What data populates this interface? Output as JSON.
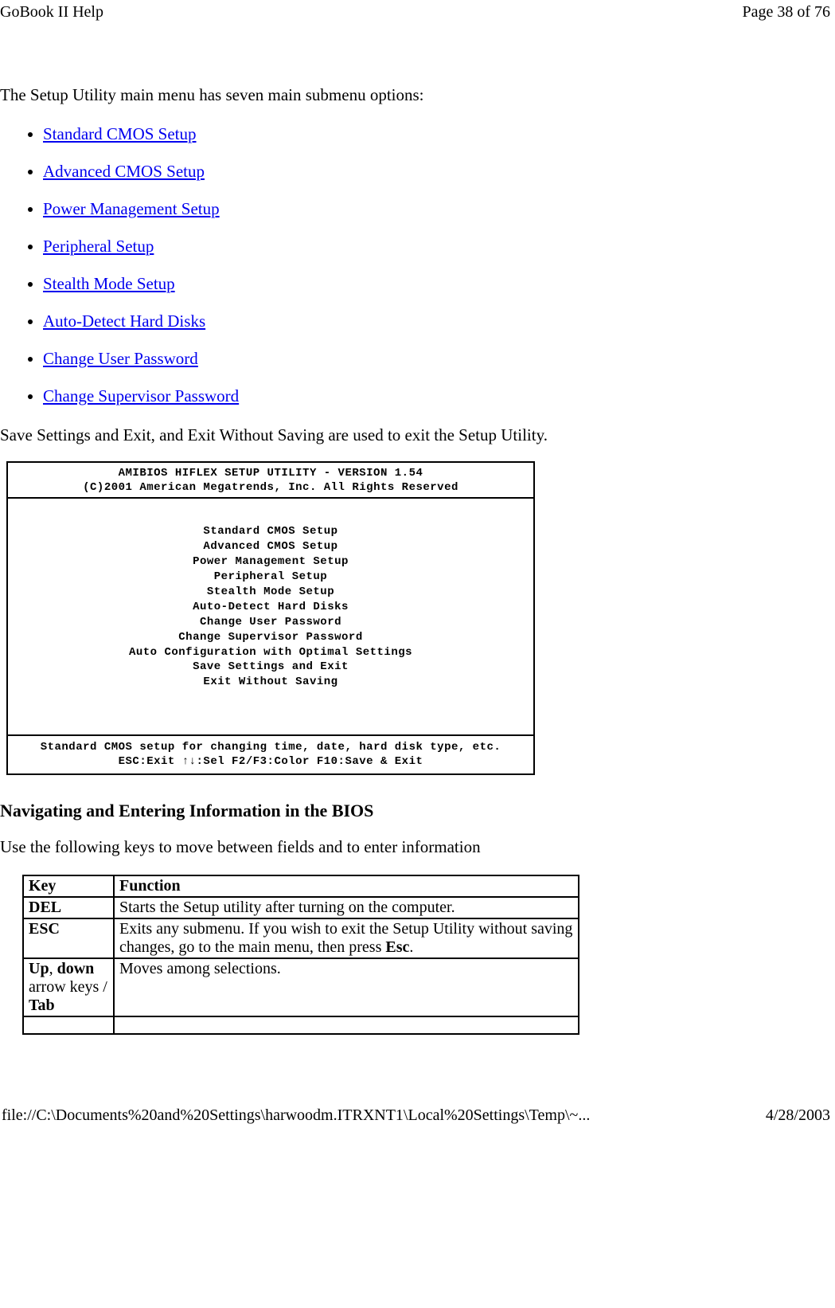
{
  "header": {
    "left": "GoBook II Help",
    "right": "Page 38 of 76"
  },
  "intro": "The Setup Utility main menu has seven main submenu options:",
  "links": [
    "Standard CMOS Setup",
    "Advanced CMOS Setup",
    "Power Management Setup",
    "Peripheral Setup",
    "Stealth Mode Setup",
    "Auto-Detect Hard Disks",
    "Change User Password",
    "Change Supervisor Password"
  ],
  "exit_note": "Save Settings and Exit, and Exit Without Saving are used to exit the Setup Utility.",
  "bios": {
    "header_line1": "AMIBIOS HIFLEX SETUP UTILITY - VERSION 1.54",
    "header_line2": "(C)2001 American Megatrends, Inc. All Rights Reserved",
    "menu": [
      "Standard CMOS Setup",
      "Advanced CMOS Setup",
      "Power Management Setup",
      "Peripheral Setup",
      "Stealth Mode Setup",
      "Auto-Detect Hard Disks",
      "Change User Password",
      "Change Supervisor Password",
      "Auto Configuration with Optimal Settings",
      "Save Settings and Exit",
      "Exit Without Saving"
    ],
    "footer_line1": "Standard CMOS setup for changing time, date, hard disk type, etc.",
    "footer_line2": "ESC:Exit  ↑↓:Sel  F2/F3:Color  F10:Save & Exit"
  },
  "heading": "Navigating and Entering Information in the BIOS",
  "nav_intro": "Use the following keys to move between fields and to enter information",
  "table": {
    "head": {
      "key": "Key",
      "func": "Function"
    },
    "rows": [
      {
        "key_bold": "DEL",
        "func_pre": "Starts the Setup utility after turning on the computer.",
        "func_bold": "",
        "func_post": ""
      },
      {
        "key_bold": "ESC",
        "func_pre": "Exits any submenu.  If you wish to exit the Setup Utility without saving changes, go to the main menu, then press ",
        "func_bold": "Esc",
        "func_post": "."
      },
      {
        "key_bold1": "Up",
        "key_sep": ", ",
        "key_bold2": "down",
        "key_tail1": " arrow keys / ",
        "key_bold3": "Tab",
        "func_pre": "Moves among selections.",
        "func_bold": "",
        "func_post": ""
      }
    ]
  },
  "footer": {
    "left": "file://C:\\Documents%20and%20Settings\\harwoodm.ITRXNT1\\Local%20Settings\\Temp\\~...",
    "right": "4/28/2003"
  }
}
